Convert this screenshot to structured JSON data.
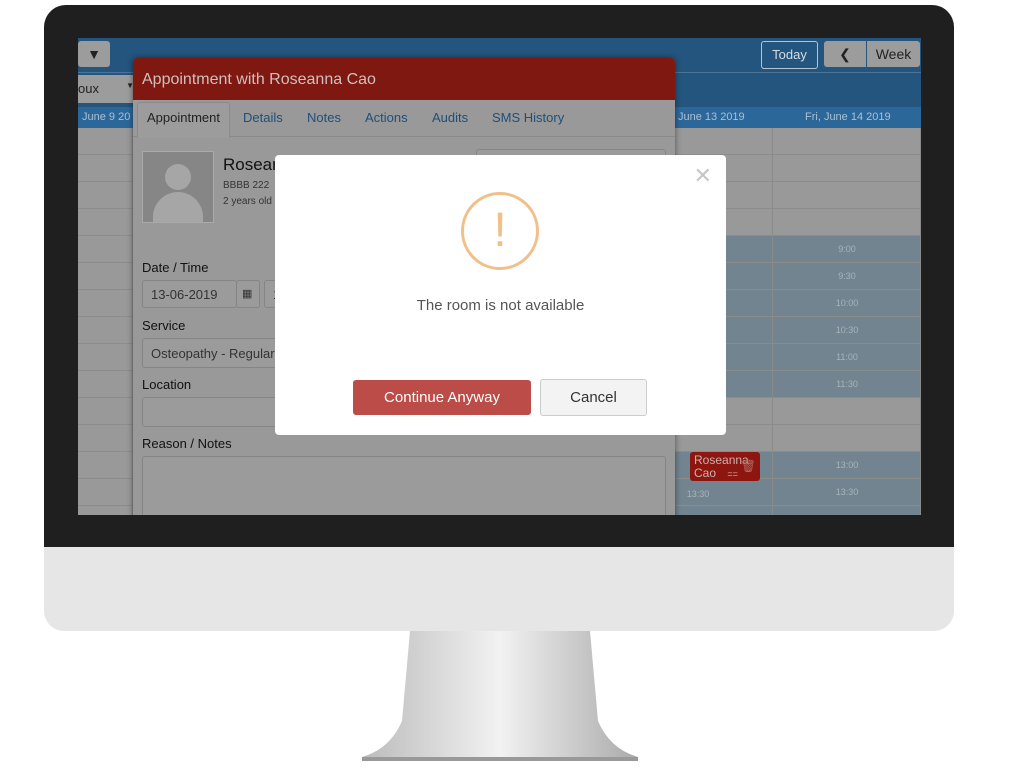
{
  "toolbar": {
    "filter_icon": "filter-icon",
    "today": "Today",
    "prev_icon": "chevron-left-icon",
    "view": "Week",
    "practitioner_select": "oux"
  },
  "calendar": {
    "days": [
      "June 9 20",
      "June 13 2019",
      "Fri, June 14 2019"
    ],
    "slots": [
      "9:00",
      "9:30",
      "10:00",
      "10:30",
      "11:00",
      "11:30",
      "13:00",
      "13:30"
    ],
    "event": {
      "line1": "Roseanna",
      "line2": "Cao",
      "handle": "==",
      "delete_icon": "trash-icon"
    },
    "left_slot": "13:30"
  },
  "dialog": {
    "title": "Appointment with Roseanna Cao",
    "tabs": [
      "Appointment",
      "Details",
      "Notes",
      "Actions",
      "Audits",
      "SMS History"
    ],
    "patient": {
      "name": "Rosear",
      "id": "BBBB 222",
      "age": "2 years old"
    },
    "date_label": "Date / Time",
    "date_value": "13-06-2019",
    "time_value": "1",
    "service_label": "Service",
    "service_value": "Osteopathy - Regular",
    "location_label": "Location",
    "location_value": "",
    "notes_label": "Reason / Notes",
    "notes_value": ""
  },
  "alert": {
    "icon": "exclamation-circle-icon",
    "message": "The room is not available",
    "continue": "Continue Anyway",
    "cancel": "Cancel",
    "accent": "#f0c08a",
    "danger": "#bb4c48"
  }
}
